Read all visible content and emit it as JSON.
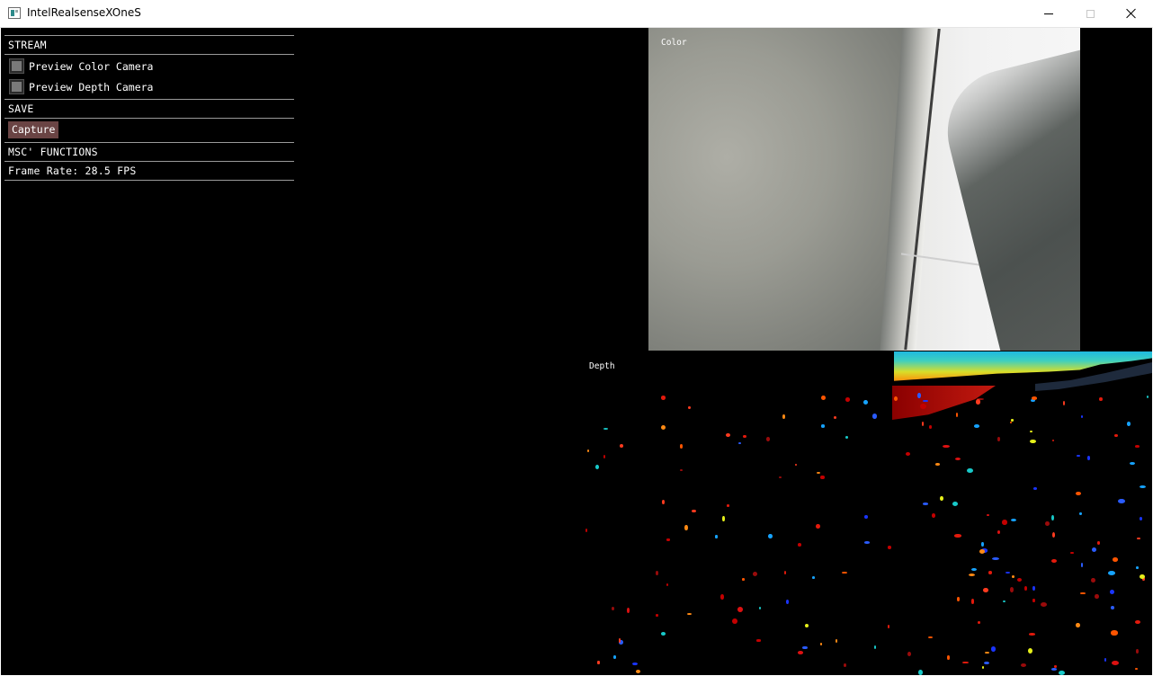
{
  "window": {
    "title": "IntelRealsenseXOneS"
  },
  "panel": {
    "stream_header": "STREAM",
    "preview_color_label": "Preview Color Camera",
    "preview_depth_label": "Preview Depth Camera",
    "save_header": "SAVE",
    "capture_label": "Capture",
    "misc_header": "MSC' FUNCTIONS",
    "frame_rate": "Frame Rate: 28.5 FPS"
  },
  "views": {
    "color_label": "Color",
    "depth_label": "Depth"
  },
  "colors": {
    "capture_button": "#6a4444",
    "background": "#000000"
  }
}
